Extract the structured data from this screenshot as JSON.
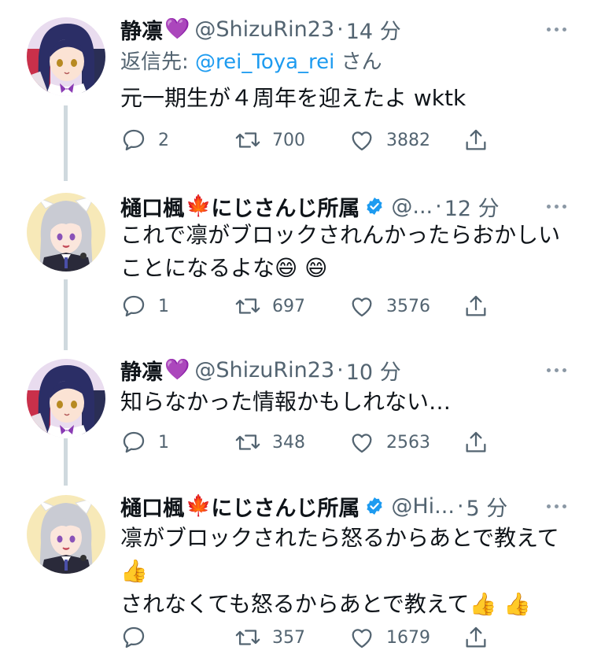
{
  "tweets": [
    {
      "name": "静凛",
      "name_emoji": "💜",
      "verified": false,
      "handle": "@ShizuRin23",
      "dot": "·",
      "time": "14 分",
      "reply_to": {
        "prefix": "返信先: ",
        "mention": "@rei_Toya_rei",
        "suffix": " さん"
      },
      "text": "元一期生が４周年を迎えたよ wktk",
      "counts": {
        "reply": "2",
        "retweet": "700",
        "like": "3882"
      },
      "avatar": "shizurin-avatar"
    },
    {
      "name": "樋口楓",
      "name_emoji": "🍁",
      "name_suffix": "にじさんじ所属",
      "verified": true,
      "handle": "@...",
      "dot": "·",
      "time": "12 分",
      "text": "これで凛がブロックされんかったらおかしい\nことになるよな😄 😄",
      "counts": {
        "reply": "1",
        "retweet": "697",
        "like": "3576"
      },
      "avatar": "higuchi-avatar"
    },
    {
      "name": "静凛",
      "name_emoji": "💜",
      "verified": false,
      "handle": "@ShizuRin23",
      "dot": "·",
      "time": "10 分",
      "text": "知らなかった情報かもしれない…",
      "counts": {
        "reply": "1",
        "retweet": "348",
        "like": "2563"
      },
      "avatar": "shizurin-avatar"
    },
    {
      "name": "樋口楓",
      "name_emoji": "🍁",
      "name_suffix": "にじさんじ所属",
      "verified": true,
      "handle": "@Hi...",
      "dot": "·",
      "time": "5 分",
      "text": "凛がブロックされたら怒るからあとで教えて\n👍\nされなくても怒るからあとで教えて👍 👍",
      "counts": {
        "reply": "",
        "retweet": "357",
        "like": "1679"
      },
      "avatar": "higuchi-avatar"
    }
  ],
  "icons": {
    "reply": "reply-icon",
    "retweet": "retweet-icon",
    "like": "heart-icon",
    "share": "share-icon",
    "more": "more-dots-icon",
    "verified": "verified-badge-icon"
  },
  "colors": {
    "text": "#0f1419",
    "secondary": "#536471",
    "link": "#1d9bf0",
    "verified": "#1d9bf0",
    "thread_line": "#cfd9de"
  }
}
